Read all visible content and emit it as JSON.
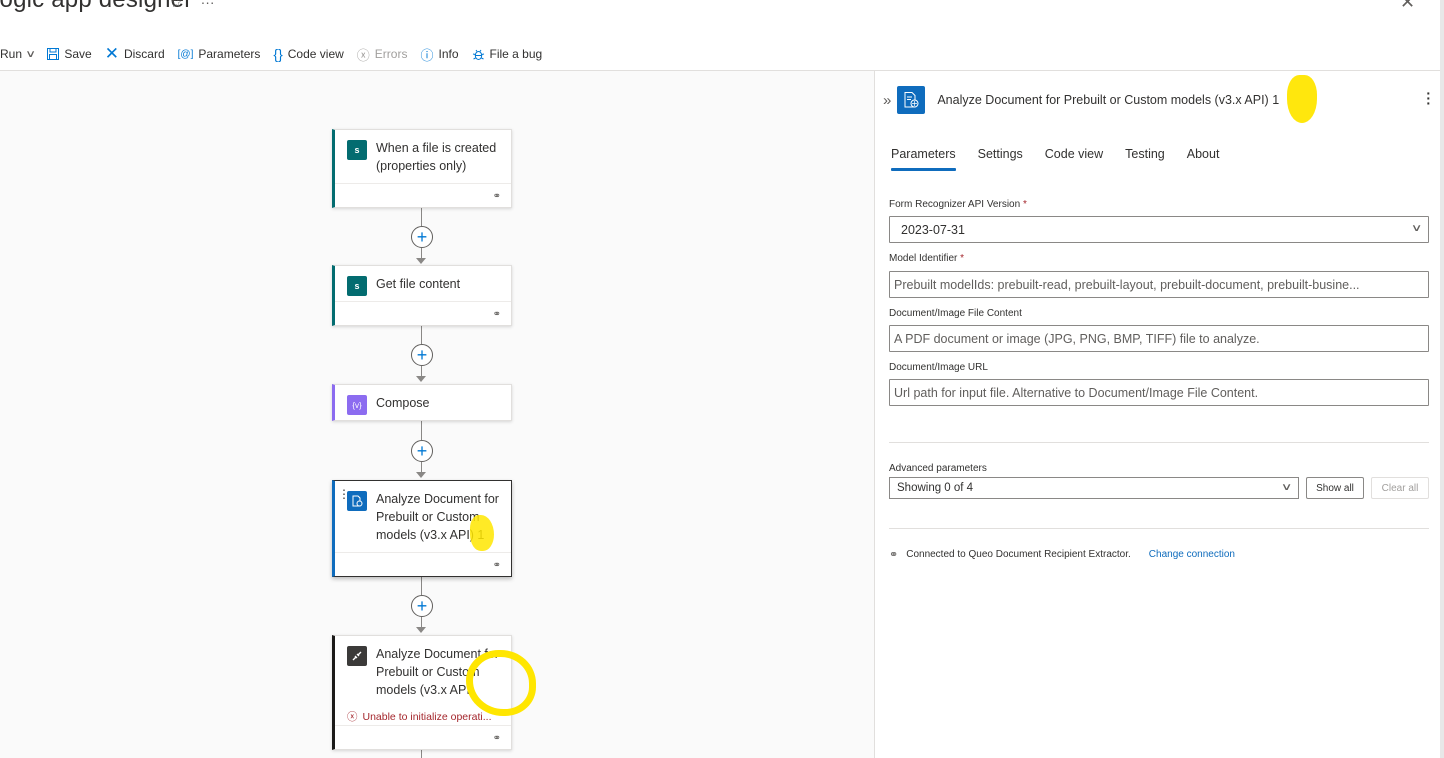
{
  "app": {
    "title": "Logic app designer",
    "favorite_icon": "star-icon",
    "more_icon": "ellipsis-icon",
    "close_icon": "close-icon"
  },
  "toolbar": {
    "run_label": "Run",
    "save_label": "Save",
    "discard_label": "Discard",
    "parameters_label": "Parameters",
    "code_view_label": "Code view",
    "errors_label": "Errors",
    "info_label": "Info",
    "file_bug_label": "File a bug"
  },
  "workflow": {
    "steps": [
      {
        "title": "When a file is created (properties only)",
        "icon": "sharepoint-icon",
        "color": "#036c70"
      },
      {
        "title": "Get file content",
        "icon": "sharepoint-icon",
        "color": "#036c70"
      },
      {
        "title": "Compose",
        "icon": "compose-variable-icon",
        "color": "#8c6cf0"
      },
      {
        "title": "Analyze Document for Prebuilt or Custom models (v3.x API) 1",
        "icon": "form-recognizer-icon",
        "color": "#0f6cbd",
        "selected": true
      },
      {
        "title": "Analyze Document for Prebuilt or Custom models (v3.x API)",
        "icon": "connector-plug-icon",
        "color": "#3b3a39",
        "error": "Unable to initialize operati..."
      }
    ]
  },
  "panel": {
    "title": "Analyze Document for Prebuilt or Custom models (v3.x API) 1",
    "tabs": [
      "Parameters",
      "Settings",
      "Code view",
      "Testing",
      "About"
    ],
    "active_tab": "Parameters",
    "fields": {
      "api_version": {
        "label": "Form Recognizer API Version",
        "required": "*",
        "value": "2023-07-31"
      },
      "model_id": {
        "label": "Model Identifier",
        "required": "*",
        "placeholder": "Prebuilt modelIds: prebuilt-read, prebuilt-layout, prebuilt-document, prebuilt-busine..."
      },
      "file_content": {
        "label": "Document/Image File Content",
        "placeholder": "A PDF document or image (JPG, PNG, BMP, TIFF) file to analyze."
      },
      "url": {
        "label": "Document/Image URL",
        "placeholder": "Url path for input file. Alternative to Document/Image File Content."
      }
    },
    "advanced": {
      "label": "Advanced parameters",
      "value": "Showing 0 of 4",
      "show_all": "Show all",
      "clear_all": "Clear all"
    },
    "connection": {
      "text": "Connected to Queo Document Recipient Extractor.",
      "change_label": "Change connection"
    }
  },
  "annotations": {
    "highlight_color": "#ffe600"
  }
}
